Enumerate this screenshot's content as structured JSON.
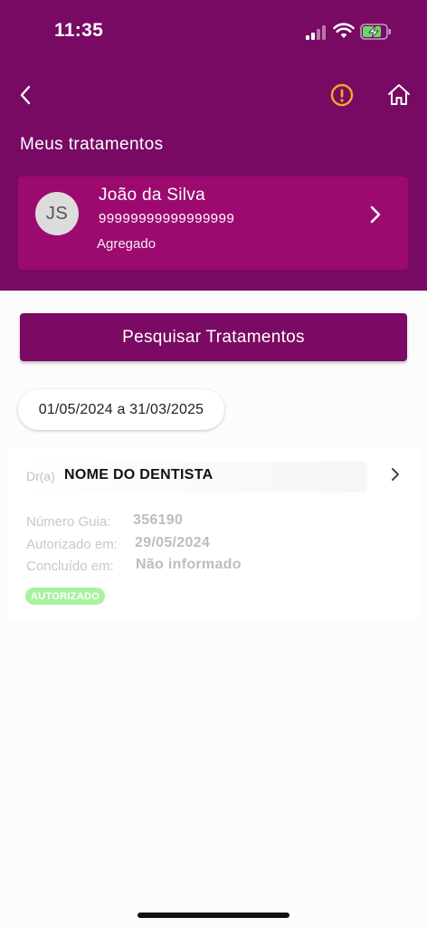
{
  "status_bar": {
    "time": "11:35"
  },
  "colors": {
    "header_bg": "#780a63",
    "card_bg": "#9c0a70",
    "alert_icon": "#f5a623",
    "badge_bg": "#a9f29f"
  },
  "header": {
    "title": "Meus tratamentos",
    "icons": [
      "chevron-left-icon",
      "alert-icon",
      "home-icon"
    ]
  },
  "patient": {
    "initials": "JS",
    "name": "João da Silva",
    "id": "99999999999999999",
    "type": "Agregado"
  },
  "search": {
    "button_label": "Pesquisar Tratamentos"
  },
  "filter": {
    "date_range": "01/05/2024 a 31/03/2025"
  },
  "treatments": [
    {
      "dentist_prefix": "Dr(a)",
      "dentist_name": "NOME DO DENTISTA",
      "guide_label": "Número Guia:",
      "guide_value": "356190",
      "authorized_label": "Autorizado em:",
      "authorized_value": "29/05/2024",
      "completed_label": "Concluído em:",
      "completed_value": "Não informado",
      "status": "AUTORIZADO"
    }
  ]
}
